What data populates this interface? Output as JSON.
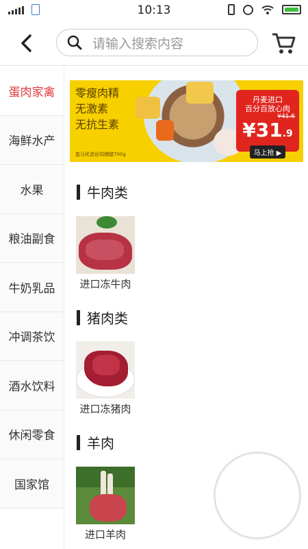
{
  "status_bar": {
    "time": "10:13"
  },
  "header": {
    "search_placeholder": "请输入搜索内容"
  },
  "sidebar": {
    "items": [
      {
        "label": "蛋肉家禽",
        "active": true
      },
      {
        "label": "海鲜水产"
      },
      {
        "label": "水果"
      },
      {
        "label": "粮油副食"
      },
      {
        "label": "牛奶乳品"
      },
      {
        "label": "冲调茶饮"
      },
      {
        "label": "酒水饮料"
      },
      {
        "label": "休闲零食"
      },
      {
        "label": "国家馆"
      }
    ]
  },
  "banner": {
    "line1": "零瘦肉精",
    "line2": "无激素",
    "line3": "无抗生素",
    "promo_line1": "丹麦进口",
    "promo_line2": "百分百放心肉",
    "old_price": "¥41.6",
    "price_main": "¥31",
    "price_decimal": ".9",
    "buy_label": "马上抢 ▶",
    "note": "盒马优选谷饲猪腱700g"
  },
  "categories": [
    {
      "title": "牛肉类",
      "product": "进口冻牛肉"
    },
    {
      "title": "猪肉类",
      "product": "进口冻猪肉"
    },
    {
      "title": "羊肉",
      "product": "进口羊肉"
    }
  ],
  "colors": {
    "accent": "#e4393c",
    "banner_bg": "#f7d000",
    "promo_red": "#e0251f"
  }
}
